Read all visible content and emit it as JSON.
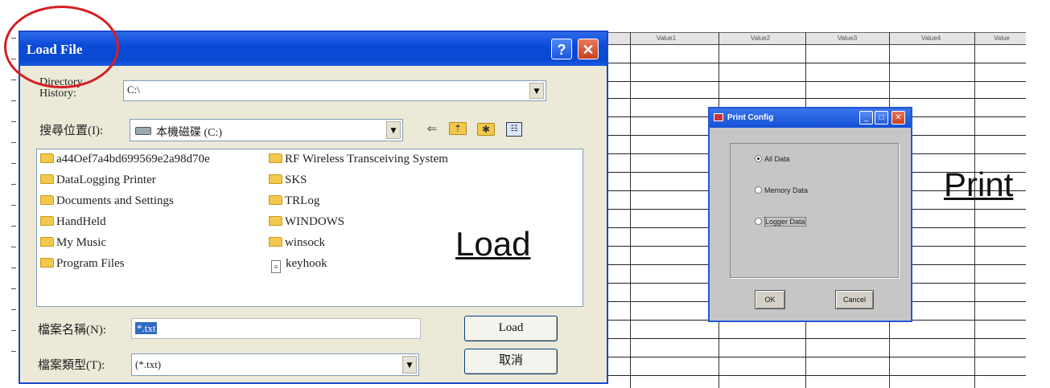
{
  "spreadsheet": {
    "columns": [
      "Value1",
      "Value2",
      "Value3",
      "Value4",
      "Value"
    ]
  },
  "load_dialog": {
    "title": "Load File",
    "help_glyph": "?",
    "close_glyph": "✕",
    "directory_history_label": "Directory\nHistory:",
    "directory_history_value": "C:\\",
    "look_in_label": "搜尋位置(I):",
    "look_in_value": "本機磁碟 (C:)",
    "files_left": [
      {
        "name": "a44Oef7a4bd699569e2a98d70e",
        "icon": "folder-icon"
      },
      {
        "name": "DataLogging Printer",
        "icon": "folder-icon"
      },
      {
        "name": "Documents and Settings",
        "icon": "folder-icon"
      },
      {
        "name": "HandHeld",
        "icon": "folder-icon"
      },
      {
        "name": "My Music",
        "icon": "folder-icon"
      },
      {
        "name": "Program Files",
        "icon": "folder-icon"
      }
    ],
    "files_right": [
      {
        "name": "RF Wireless Transceiving System",
        "icon": "folder-icon"
      },
      {
        "name": "SKS",
        "icon": "folder-icon"
      },
      {
        "name": "TRLog",
        "icon": "folder-icon"
      },
      {
        "name": "WINDOWS",
        "icon": "folder-icon"
      },
      {
        "name": "winsock",
        "icon": "folder-icon"
      },
      {
        "name": "keyhook",
        "icon": "file-icon"
      }
    ],
    "filename_label": "檔案名稱(N):",
    "filename_value": "*.txt",
    "filetype_label": "檔案類型(T):",
    "filetype_value": "(*.txt)",
    "load_button": "Load",
    "cancel_button": "取消"
  },
  "annotations": {
    "load_caption": "Load",
    "print_caption": "Print"
  },
  "print_dialog": {
    "title": "Print Config",
    "options": [
      {
        "label": "All Data",
        "selected": true
      },
      {
        "label": "Memory Data",
        "selected": false
      },
      {
        "label": "Logger Data",
        "selected": false
      }
    ],
    "ok_button": "OK",
    "cancel_button": "Cancel"
  },
  "colors": {
    "titlebar_blue": "#0b4ad8",
    "highlight_red": "#d61e23",
    "dialog_bg": "#ece9d8"
  }
}
